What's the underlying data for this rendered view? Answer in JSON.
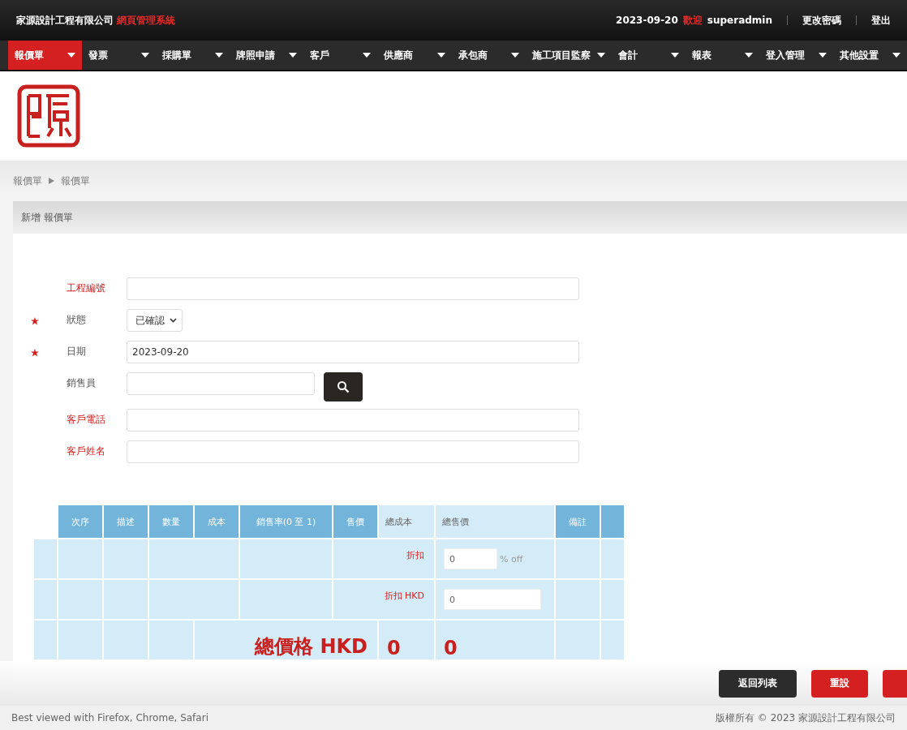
{
  "header": {
    "company": "家源設計工程有限公司",
    "system": "網頁管理系統",
    "date": "2023-09-20",
    "welcome": "歡迎",
    "user": "superadmin",
    "links": [
      "更改密碼",
      "登出"
    ]
  },
  "menu": [
    {
      "label": "報價單",
      "selected": true
    },
    {
      "label": "發票",
      "selected": false
    },
    {
      "label": "採購單",
      "selected": false
    },
    {
      "label": "牌照申請",
      "selected": false
    },
    {
      "label": "客戶",
      "selected": false
    },
    {
      "label": "供應商",
      "selected": false
    },
    {
      "label": "承包商",
      "selected": false
    },
    {
      "label": "施工項目監察",
      "selected": false
    },
    {
      "label": "會計",
      "selected": false
    },
    {
      "label": "報表",
      "selected": false
    },
    {
      "label": "登入管理",
      "selected": false
    },
    {
      "label": "其他設置",
      "selected": false
    }
  ],
  "breadcrumb": [
    "報價單",
    "報價單"
  ],
  "panel_title": "新增 報價單",
  "fields": [
    {
      "kind": "text",
      "label": "工程編號",
      "required": false,
      "emphasized": true
    },
    {
      "kind": "select",
      "label": "狀態",
      "required": true,
      "emphasized": false,
      "value": "已確認"
    },
    {
      "kind": "text",
      "label": "日期",
      "required": true,
      "emphasized": false,
      "value": "2023-09-20"
    },
    {
      "kind": "search",
      "label": "銷售員",
      "required": false,
      "emphasized": false
    },
    {
      "kind": "text",
      "label": "客戶電話",
      "required": false,
      "emphasized": true
    },
    {
      "kind": "text",
      "label": "客戶姓名",
      "required": false,
      "emphasized": true
    }
  ],
  "table": {
    "columns": [
      {
        "label": "次序",
        "shaded": true
      },
      {
        "label": "描述",
        "shaded": true
      },
      {
        "label": "數量",
        "shaded": true
      },
      {
        "label": "成本",
        "shaded": true
      },
      {
        "label": "銷售率(0 至 1)",
        "shaded": true
      },
      {
        "label": "售價",
        "shaded": true
      },
      {
        "label": "總成本",
        "shaded": false
      },
      {
        "label": "總售價",
        "shaded": false
      },
      {
        "label": "備註",
        "shaded": true
      }
    ],
    "rows": [
      {
        "kind": "discount",
        "label": "折扣",
        "value": "0",
        "unit": "% off"
      },
      {
        "kind": "discount_amount",
        "label": "折扣 HKD",
        "value": "0"
      },
      {
        "kind": "total",
        "label": "總價格 HKD",
        "total_cost": "0",
        "total_price": "0"
      }
    ]
  },
  "buttons": [
    {
      "label": "返回列表",
      "kind": "dark"
    },
    {
      "label": "重設",
      "kind": "red"
    },
    {
      "kind": "red"
    }
  ],
  "footer": {
    "note": "Best viewed with Firefox, Chrome, Safari",
    "copyright": "版權所有 © 2023 家源設計工程有限公司"
  }
}
